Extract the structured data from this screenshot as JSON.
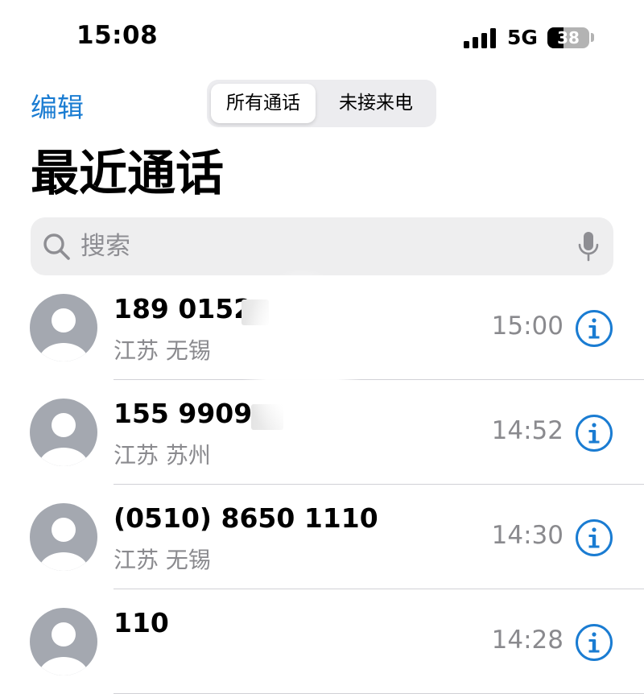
{
  "status_bar": {
    "time": "15:08",
    "network": "5G",
    "battery_level": "38",
    "signal_icon": "cellular-signal-icon",
    "battery_icon": "battery-icon"
  },
  "header": {
    "edit_label": "编辑",
    "segments": [
      {
        "label": "所有通话",
        "active": true
      },
      {
        "label": "未接来电",
        "active": false
      }
    ],
    "title": "最近通话"
  },
  "search": {
    "placeholder": "搜索",
    "search_icon": "search-icon",
    "mic_icon": "microphone-icon"
  },
  "calls": [
    {
      "number": "189 0152",
      "location": "江苏 无锡",
      "time": "15:00"
    },
    {
      "number": "155 9909",
      "location": "江苏 苏州",
      "time": "14:52"
    },
    {
      "number": "(0510) 8650 1110",
      "location": "江苏 无锡",
      "time": "14:30"
    },
    {
      "number": "110",
      "location": "",
      "time": "14:28"
    }
  ],
  "colors": {
    "accent": "#1a7cd2",
    "secondary_text": "#8a8a8e",
    "avatar": "#a4a8b0"
  }
}
